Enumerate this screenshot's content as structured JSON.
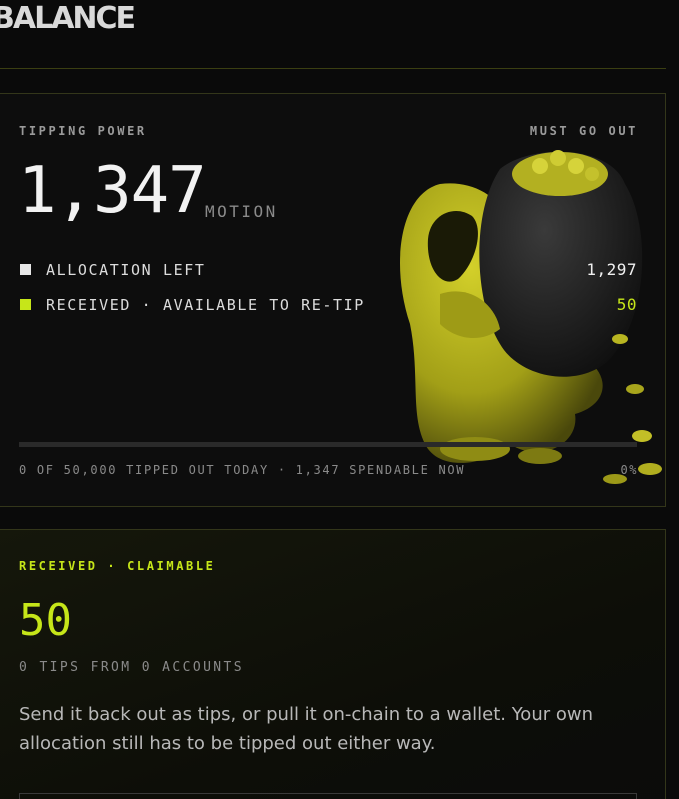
{
  "page": {
    "title": "BALANCE"
  },
  "colors": {
    "accent": "#c6e619",
    "allocation_swatch": "#e8e8e8",
    "received_swatch": "#c6e619"
  },
  "tipping_power": {
    "label": "TIPPING POWER",
    "badge": "MUST GO OUT",
    "value": "1,347",
    "unit": "MOTION",
    "legend": [
      {
        "label": "ALLOCATION LEFT",
        "value": "1,297"
      },
      {
        "label": "RECEIVED · AVAILABLE TO RE-TIP",
        "value": "50"
      }
    ],
    "progress": {
      "fraction": 0,
      "caption": "0 OF 50,000 TIPPED OUT TODAY · 1,347 SPENDABLE NOW",
      "percent_label": "0%"
    },
    "mascot_icon": "money-bag-mascot-icon"
  },
  "claimable": {
    "label": "RECEIVED · CLAIMABLE",
    "value": "50",
    "subtitle": "0 TIPS FROM 0 ACCOUNTS",
    "description": "Send it back out as tips, or pull it on-chain to a wallet. Your own allocation still has to be tipped out either way."
  }
}
